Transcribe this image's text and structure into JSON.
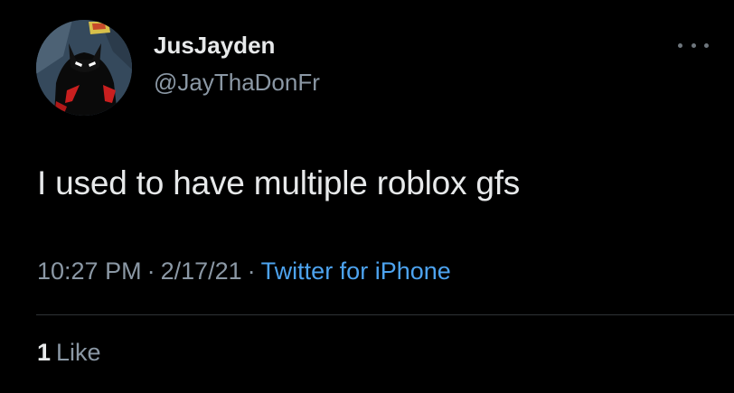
{
  "tweet": {
    "author": {
      "display_name": "JusJayden",
      "handle": "@JayThaDonFr",
      "avatar_icon": "batman-beyond-avatar-icon"
    },
    "more_icon": "more-options-icon",
    "text": "I used to have multiple roblox gfs",
    "time": "10:27 PM",
    "separator": "·",
    "date": "2/17/21",
    "source": "Twitter for iPhone",
    "likes": {
      "count": "1",
      "label": "Like"
    }
  },
  "colors": {
    "background": "#000000",
    "primary_text": "#e7e9ea",
    "secondary_text": "#8b98a5",
    "link": "#4da3ef",
    "divider": "#2f3336"
  }
}
